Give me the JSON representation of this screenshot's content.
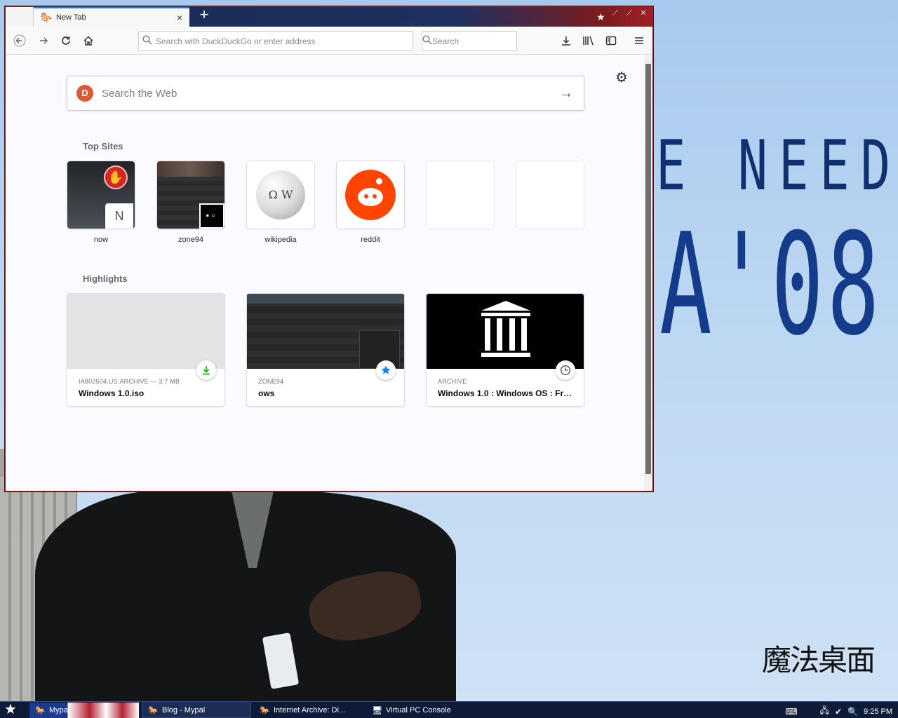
{
  "browser": {
    "tab": {
      "title": "New Tab",
      "close_label": "×"
    },
    "new_tab_label": "+",
    "url_placeholder": "Search with DuckDuckGo or enter address",
    "search_placeholder": "Search"
  },
  "newtab": {
    "web_search_placeholder": "Search the Web",
    "top_sites_heading": "Top Sites",
    "top_sites": [
      {
        "label": "now",
        "badge": "N"
      },
      {
        "label": "zone94"
      },
      {
        "label": "wikipedia"
      },
      {
        "label": "reddit"
      },
      {
        "label": ""
      },
      {
        "label": ""
      }
    ],
    "highlights_heading": "Highlights",
    "highlights": [
      {
        "source": "IA802504.US.ARCHIVE — 3.7 MB",
        "title": "Windows 1.0.iso",
        "badge_icon": "download-icon"
      },
      {
        "source": "ZONE94",
        "title": "ows",
        "badge_icon": "star-icon"
      },
      {
        "source": "ARCHIVE",
        "title": "Windows 1.0 : Windows OS : Fre...",
        "badge_icon": "clock-icon"
      }
    ]
  },
  "wallpaper": {
    "line1": "E NEED",
    "line2": "A'08",
    "logo": "魔法桌面"
  },
  "taskbar": {
    "items": [
      {
        "label": "Mypal"
      },
      {
        "label": "Blog - Mypal"
      },
      {
        "label": "Internet Archive: Di..."
      },
      {
        "label": "Virtual PC Console"
      }
    ],
    "clock": "9:25 PM"
  },
  "colors": {
    "accent": "#0a84ff",
    "reddit": "#ff4500",
    "duckduckgo": "#de5833",
    "download_green": "#12bc00",
    "taskbar": "#0d1a38"
  }
}
